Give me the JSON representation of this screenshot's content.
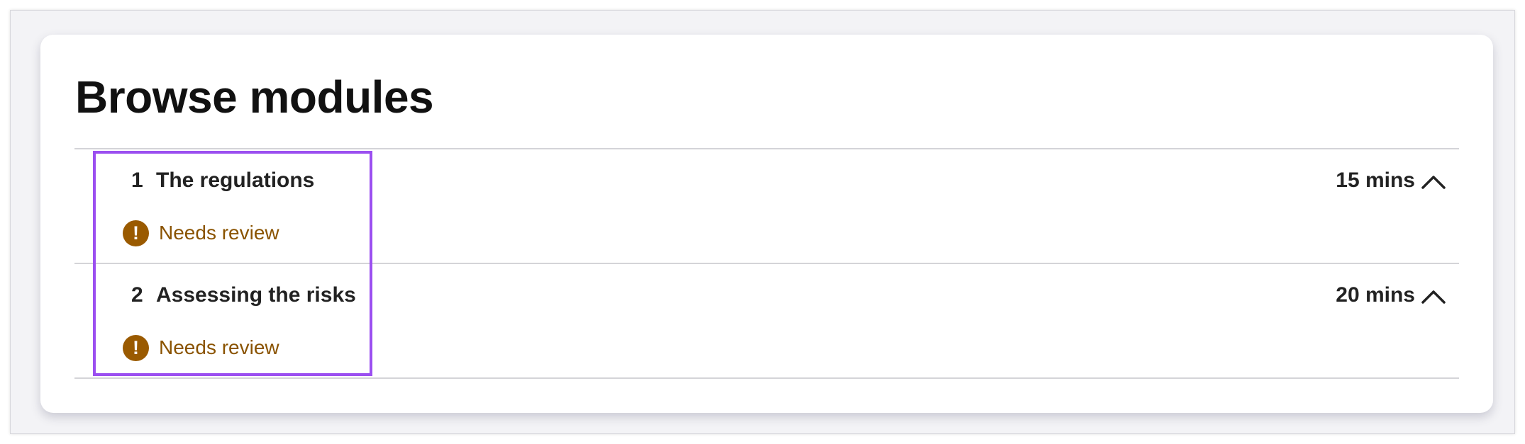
{
  "page": {
    "title": "Browse modules"
  },
  "modules": [
    {
      "number": "1",
      "title": "The regulations",
      "status": "Needs review",
      "duration": "15 mins",
      "toggle_icon": "chevron-up-icon"
    },
    {
      "number": "2",
      "title": "Assessing the risks",
      "status": "Needs review",
      "duration": "20 mins",
      "toggle_icon": "chevron-up-icon"
    }
  ],
  "icons": {
    "status": "warning-icon",
    "status_glyph": "!"
  },
  "colors": {
    "status_icon": "#9a5a00",
    "status_text": "#8a5300",
    "highlight": "#9b4ff0"
  }
}
